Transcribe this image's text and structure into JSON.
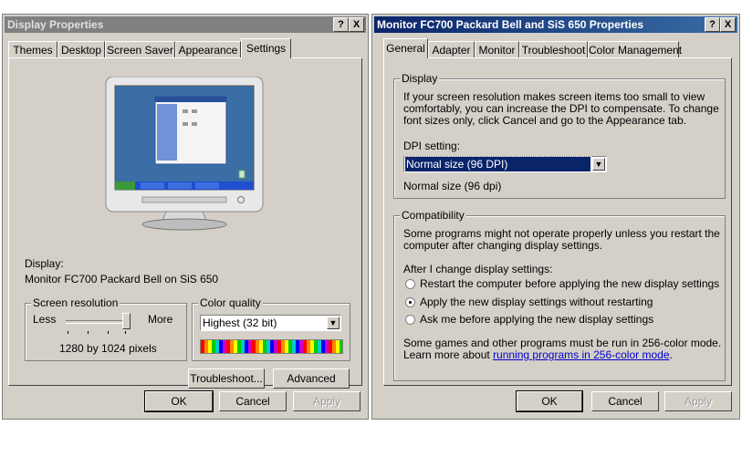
{
  "display_properties": {
    "title": "Display Properties",
    "help_button": "?",
    "close_button": "X",
    "tabs": [
      {
        "label": "Themes"
      },
      {
        "label": "Desktop"
      },
      {
        "label": "Screen Saver"
      },
      {
        "label": "Appearance"
      },
      {
        "label": "Settings"
      }
    ],
    "active_tab": "Settings",
    "display_label": "Display:",
    "display_value": "Monitor FC700 Packard Bell on SiS 650",
    "screen_resolution": {
      "legend": "Screen resolution",
      "less_label": "Less",
      "more_label": "More",
      "value_text": "1280 by 1024 pixels"
    },
    "color_quality": {
      "legend": "Color quality",
      "selected": "Highest (32 bit)"
    },
    "troubleshoot_label": "Troubleshoot...",
    "advanced_label": "Advanced",
    "ok_label": "OK",
    "cancel_label": "Cancel",
    "apply_label": "Apply"
  },
  "monitor_properties": {
    "title": "Monitor FC700 Packard Bell and SiS 650 Properties",
    "help_button": "?",
    "close_button": "X",
    "tabs": [
      {
        "label": "General"
      },
      {
        "label": "Adapter"
      },
      {
        "label": "Monitor"
      },
      {
        "label": "Troubleshoot"
      },
      {
        "label": "Color Management"
      }
    ],
    "active_tab": "General",
    "display_group": {
      "legend": "Display",
      "description_line1": "If your screen resolution makes screen items too small to view",
      "description_line2": "comfortably, you can increase the DPI to compensate.  To change",
      "description_line3": "font sizes only, click Cancel and go to the Appearance tab.",
      "dpi_label": "DPI setting:",
      "dpi_selected": "Normal size (96 DPI)",
      "dpi_note": "Normal size (96 dpi)"
    },
    "compatibility_group": {
      "legend": "Compatibility",
      "line1": "Some programs might not operate properly unless you restart the",
      "line2": "computer after changing display settings.",
      "after_label": "After I change display settings:",
      "options": [
        {
          "label": "Restart the computer before applying the new display settings",
          "checked": false
        },
        {
          "label": "Apply the new display settings without restarting",
          "checked": true
        },
        {
          "label": "Ask me before applying the new display settings",
          "checked": false
        }
      ],
      "note_line1": "Some games and other programs must be run in 256-color mode.",
      "note_line2_prefix": "Learn more about ",
      "note_link": "running programs in 256-color mode",
      "note_line2_suffix": "."
    },
    "ok_label": "OK",
    "cancel_label": "Cancel",
    "apply_label": "Apply"
  }
}
